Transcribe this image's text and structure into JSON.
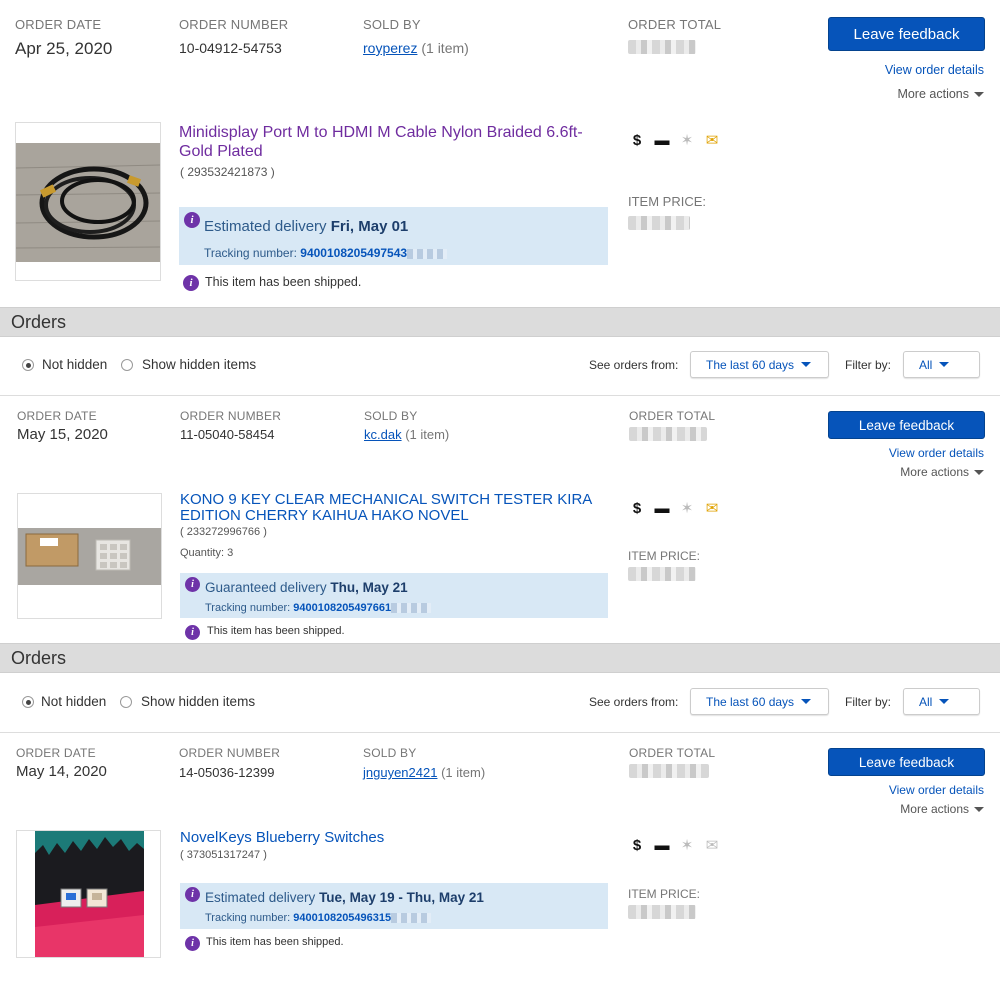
{
  "labels": {
    "order_date": "ORDER DATE",
    "order_number": "ORDER NUMBER",
    "sold_by": "SOLD BY",
    "order_total": "ORDER TOTAL",
    "item_price": "ITEM PRICE:",
    "leave_feedback": "Leave feedback",
    "view_order_details": "View order details",
    "more_actions": "More actions",
    "shipped": "This item has been shipped.",
    "tracking_number": "Tracking number:"
  },
  "orders_section": {
    "title": "Orders",
    "not_hidden": "Not hidden",
    "show_hidden": "Show hidden items",
    "see_orders_from": "See orders from:",
    "period": "The last 60 days",
    "filter_by": "Filter by:",
    "filter_value": "All"
  },
  "orders": [
    {
      "date": "Apr 25, 2020",
      "number": "10-04912-54753",
      "seller": "royperez",
      "item_count": "(1 item)",
      "item_title": "Minidisplay Port M to HDMI M Cable Nylon Braided 6.6ft-Gold Plated",
      "item_id": "( 293532421873 )",
      "quantity": "",
      "delivery_prefix": "Estimated delivery",
      "delivery_date": "Fri, May 01",
      "tracking": "9400108205497543"
    },
    {
      "date": "May 15, 2020",
      "number": "11-05040-58454",
      "seller": "kc.dak",
      "item_count": "(1 item)",
      "item_title": "KONO 9 KEY CLEAR MECHANICAL SWITCH TESTER KIRA EDITION CHERRY KAIHUA HAKO NOVEL",
      "item_id": "( 233272996766 )",
      "quantity": "Quantity: 3",
      "delivery_prefix": "Guaranteed delivery",
      "delivery_date": "Thu, May 21",
      "tracking": "9400108205497661"
    },
    {
      "date": "May 14, 2020",
      "number": "14-05036-12399",
      "seller": "jnguyen2421",
      "item_count": "(1 item)",
      "item_title": "NovelKeys Blueberry Switches",
      "item_id": "( 373051317247 )",
      "quantity": "",
      "delivery_prefix": "Estimated delivery",
      "delivery_date": "Tue, May 19 - Thu, May 21",
      "tracking": "9400108205496315"
    }
  ],
  "icons": [
    "dollar-icon",
    "card-icon",
    "feedback-star-icon",
    "envelope-icon"
  ],
  "colors": {
    "accent": "#0654ba",
    "visited_link": "#6f2c9f",
    "info": "#6e33a8",
    "delivery_bg": "#d8e8f5"
  }
}
